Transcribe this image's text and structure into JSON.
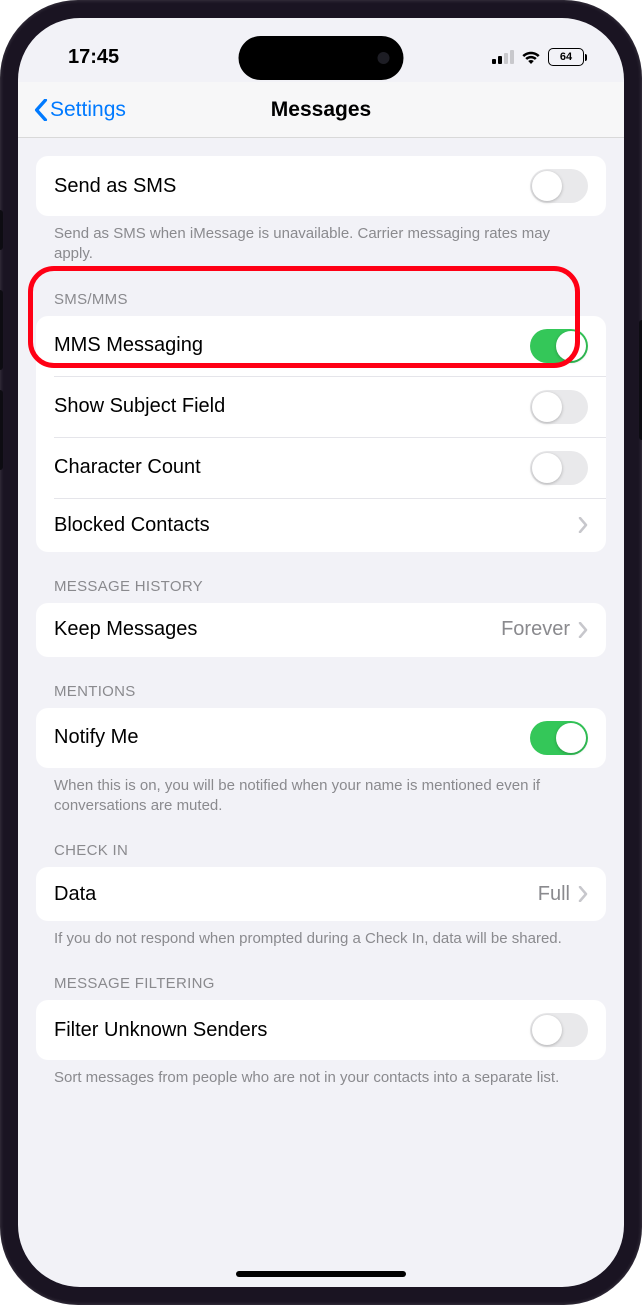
{
  "status_bar": {
    "time": "17:45",
    "battery": "64"
  },
  "nav": {
    "back": "Settings",
    "title": "Messages"
  },
  "send_sms": {
    "label": "Send as SMS",
    "footer": "Send as SMS when iMessage is unavailable. Carrier messaging rates may apply."
  },
  "sms_mms": {
    "header": "SMS/MMS",
    "mms": "MMS Messaging",
    "subject": "Show Subject Field",
    "count": "Character Count",
    "blocked": "Blocked Contacts"
  },
  "history": {
    "header": "MESSAGE HISTORY",
    "keep": "Keep Messages",
    "keep_value": "Forever"
  },
  "mentions": {
    "header": "MENTIONS",
    "notify": "Notify Me",
    "footer": "When this is on, you will be notified when your name is mentioned even if conversations are muted."
  },
  "checkin": {
    "header": "CHECK IN",
    "data": "Data",
    "data_value": "Full",
    "footer": "If you do not respond when prompted during a Check In, data will be shared."
  },
  "filtering": {
    "header": "MESSAGE FILTERING",
    "filter": "Filter Unknown Senders",
    "footer": "Sort messages from people who are not in your contacts into a separate list."
  }
}
